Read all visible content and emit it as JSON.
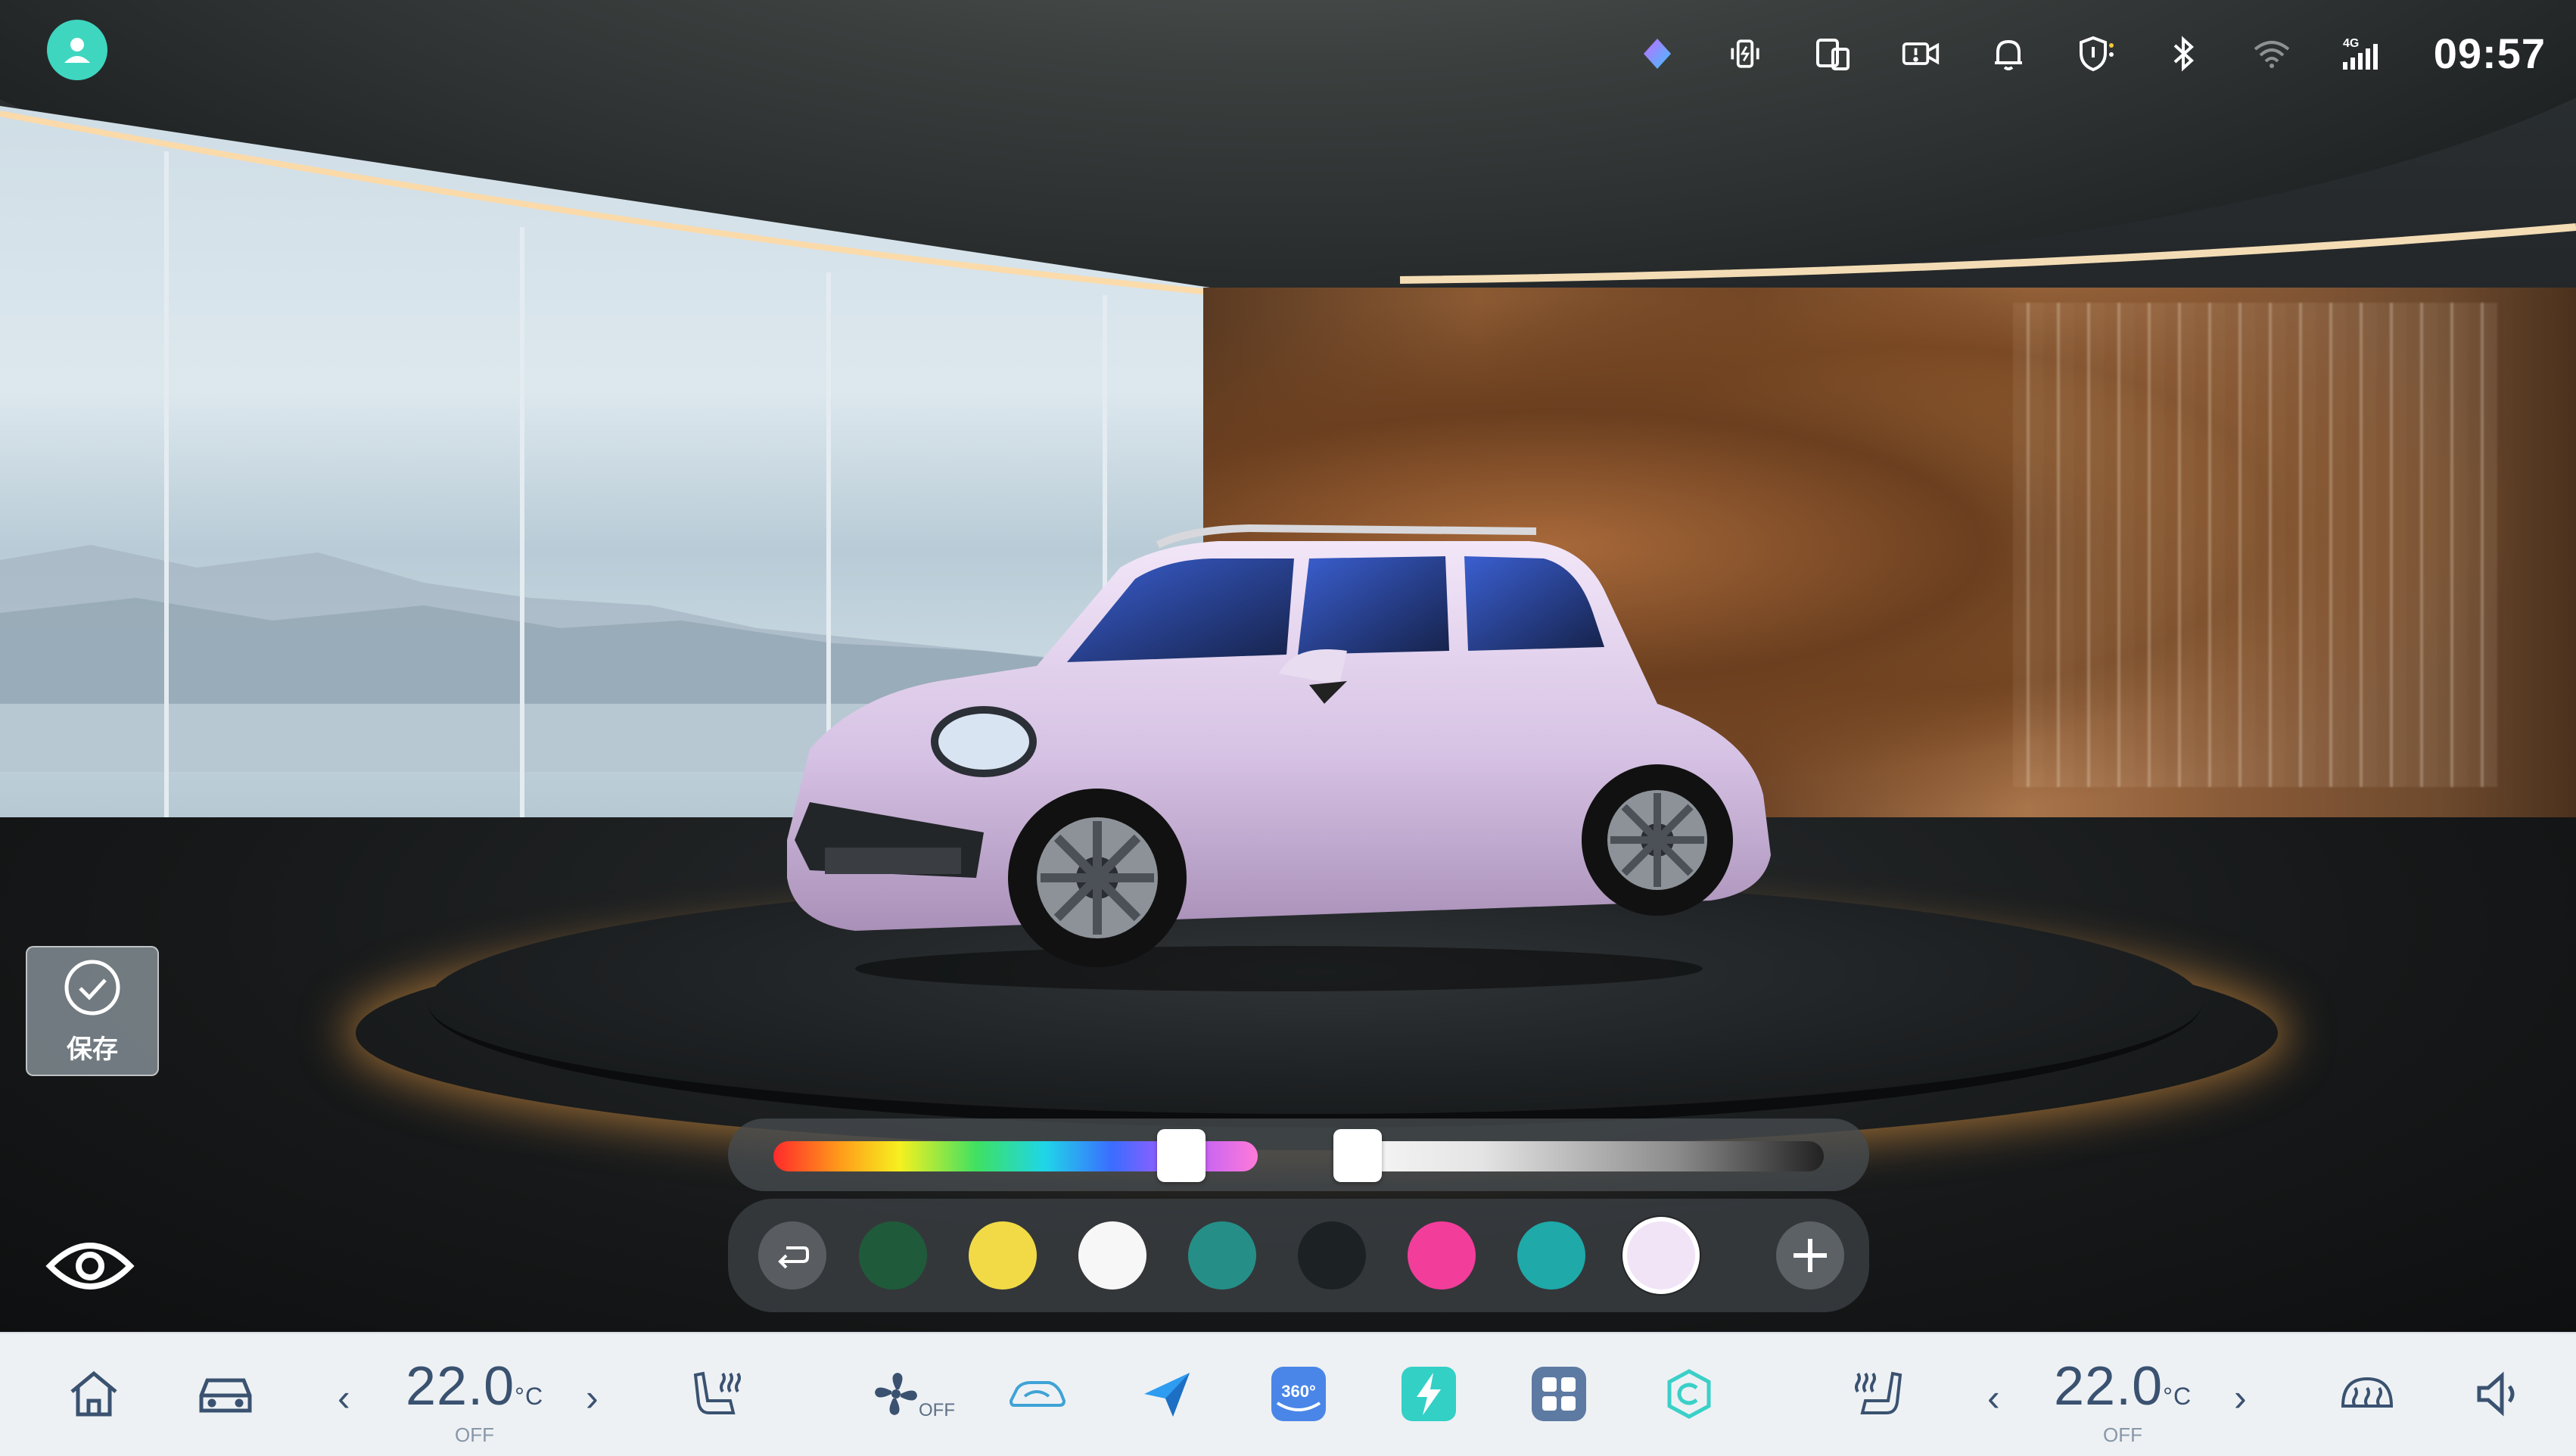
{
  "status_bar": {
    "time": "09:57",
    "icons": [
      "ai-assistant-icon",
      "phone-charging-icon",
      "device-link-icon",
      "dashcam-icon",
      "notification-bell-icon",
      "security-shield-icon",
      "bluetooth-icon",
      "wifi-icon",
      "cellular-4g-icon"
    ],
    "network_label": "4G"
  },
  "left_controls": {
    "save_label": "保存"
  },
  "color_picker": {
    "hue_position": 0.42,
    "lightness_position": 0.05,
    "swatches": [
      "#1f5b3b",
      "#f1da46",
      "#f7f7f7",
      "#258f87",
      "#1c2224",
      "#f23d9b",
      "#1fa9a9",
      "#f1e4f7"
    ],
    "selected_swatch_index": 7
  },
  "dock": {
    "left_temp": {
      "value": "22.0",
      "unit": "°C",
      "status": "OFF"
    },
    "right_temp": {
      "value": "22.0",
      "unit": "°C",
      "status": "OFF"
    },
    "fan_status": "OFF",
    "prev_arrow": "‹",
    "next_arrow": "›",
    "app_360_label": "360°"
  },
  "colors": {
    "accent": "#3fd6c0",
    "dock_bg": "#eef1f4",
    "dock_text": "#3a5270"
  }
}
